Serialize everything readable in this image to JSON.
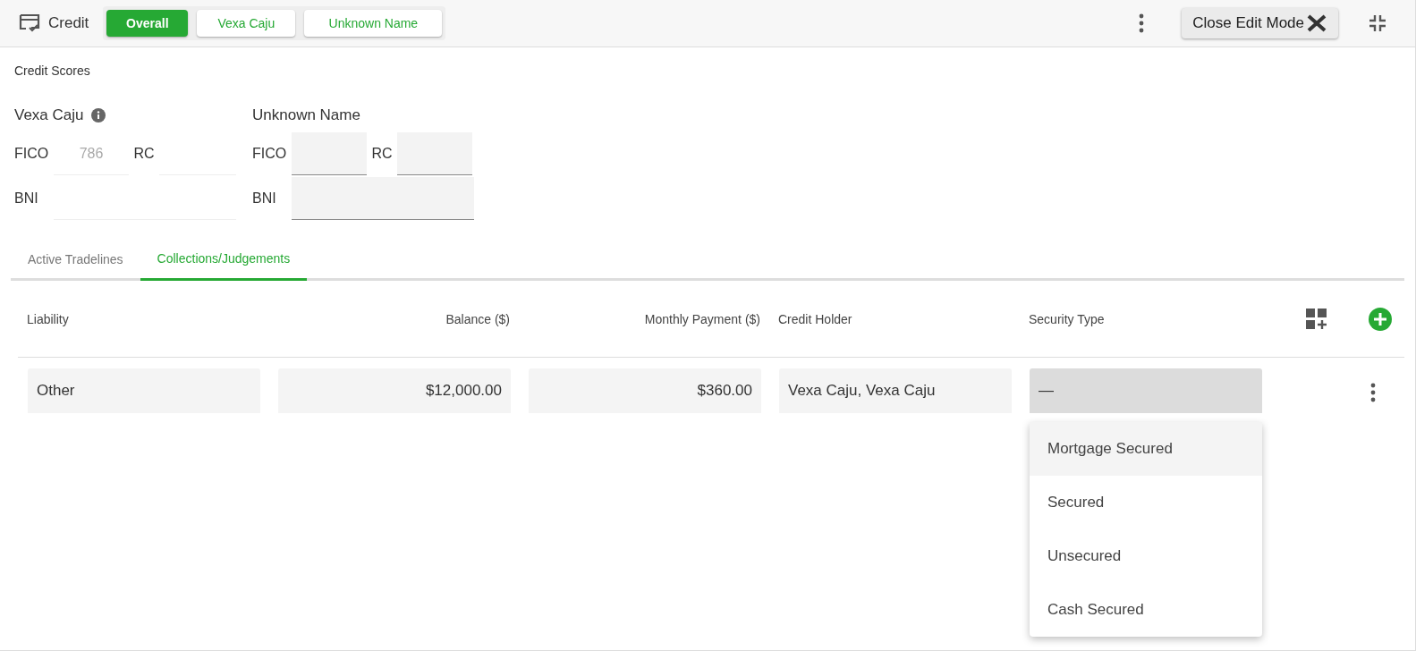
{
  "header": {
    "title": "Credit",
    "person_tabs": [
      {
        "label": "Overall",
        "selected": true
      },
      {
        "label": "Vexa Caju",
        "selected": false
      },
      {
        "label": "Unknown Name",
        "selected": false
      }
    ],
    "edit_button": "Close Edit Mode"
  },
  "credit_scores": {
    "title": "Credit Scores",
    "people": [
      {
        "name": "Vexa Caju",
        "info": true,
        "kind": "underlined",
        "fico_label": "FICO",
        "fico_value": "786",
        "rc_label": "RC",
        "bni_label": "BNI"
      },
      {
        "name": "Unknown Name",
        "info": false,
        "kind": "filled",
        "fico_label": "FICO",
        "rc_label": "RC",
        "bni_label": "BNI"
      }
    ]
  },
  "section_tabs": [
    {
      "label": "Active Tradelines",
      "selected": false
    },
    {
      "label": "Collections/Judgements",
      "selected": true
    }
  ],
  "table": {
    "columns": [
      {
        "label": "Liability",
        "kind": "text"
      },
      {
        "label": "Balance ($)",
        "kind": "amount"
      },
      {
        "label": "Monthly Payment ($)",
        "kind": "amount"
      },
      {
        "label": "Credit Holder",
        "kind": "text"
      },
      {
        "label": "Security Type",
        "kind": "text"
      }
    ],
    "rows": [
      {
        "cells": [
          {
            "value": "Other",
            "kind": "text"
          },
          {
            "value": "$12,000.00",
            "kind": "amount"
          },
          {
            "value": "$360.00",
            "kind": "amount"
          },
          {
            "value": "Vexa Caju, Vexa Caju",
            "kind": "text"
          },
          {
            "value": "—",
            "kind": "select",
            "expanded": true,
            "options": [
              {
                "label": "Mortgage Secured",
                "highlighted": true
              },
              {
                "label": "Secured",
                "highlighted": false
              },
              {
                "label": "Unsecured",
                "highlighted": false
              },
              {
                "label": "Cash Secured",
                "highlighted": false
              }
            ]
          }
        ]
      }
    ]
  }
}
